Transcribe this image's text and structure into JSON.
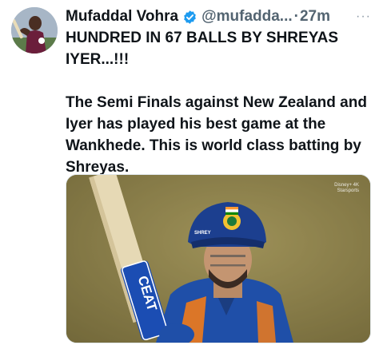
{
  "tweet": {
    "author_name": "Mufaddal Vohra",
    "handle": "@mufadda...",
    "separator": "·",
    "time": "27m",
    "more": "···",
    "text_line_1": "HUNDRED IN 67 BALLS BY SHREYAS IYER...!!!",
    "text_line_2": "The Semi Finals against New Zealand and Iyer has played his best game at the Wankhede. This is world class batting by Shreyas.",
    "verified_color": "#1d9bf0",
    "avatar_icon": "avatar-cricketer",
    "media": {
      "bat_brand": "CEAT",
      "watermark": "Disney+ 4K\nStarsports"
    }
  }
}
